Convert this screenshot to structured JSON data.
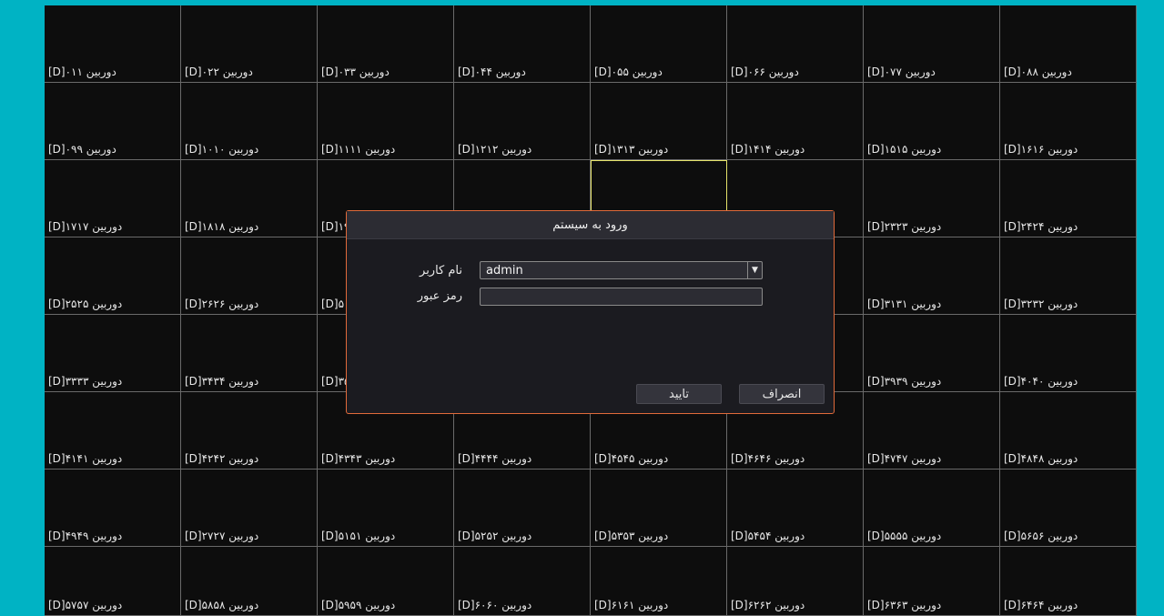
{
  "cameras": [
    "[D]۰۱دوربین ۱",
    "[D]۰۲دوربین ۲",
    "[D]۰۳دوربین ۳",
    "[D]۰۴دوربین ۴",
    "[D]۰۵دوربین ۵",
    "[D]۰۶دوربین ۶",
    "[D]۰۷دوربین ۷",
    "[D]۰۸دوربین ۸",
    "[D]۰۹دوربین ۹",
    "[D]۱۰دوربین ۱۰",
    "[D]۱۱دوربین ۱۱",
    "[D]۱۲دوربین ۱۲",
    "[D]۱۳دوربین ۱۳",
    "[D]۱۴دوربین ۱۴",
    "[D]۱۵دوربین ۱۵",
    "[D]۱۶دوربین ۱۶",
    "[D]۱۷دوربین ۱۷",
    "[D]۱۸دوربین ۱۸",
    "[D]۱۹دوربین ۱۹",
    "",
    "",
    "",
    "[D]۲۳دوربین ۲۳",
    "[D]۲۴دوربین ۲۴",
    "[D]۲۵دوربین ۲۵",
    "[D]۲۶دوربین ۲۶",
    "[D]۵۰دوربین ۵۰",
    "",
    "",
    "",
    "[D]۳۱دوربین ۳۱",
    "[D]۳۲دوربین ۳۲",
    "[D]۳۳دوربین ۳۳",
    "[D]۳۴دوربین ۳۴",
    "[D]۳۵دوربین ۳۵",
    "",
    "",
    "",
    "[D]۳۹دوربین ۳۹",
    "[D]۴۰دوربین ۴۰",
    "[D]۴۱دوربین ۴۱",
    "[D]۴۲دوربین ۴۲",
    "[D]۴۳دوربین ۴۳",
    "[D]۴۴دوربین ۴۴",
    "[D]۴۵دوربین ۴۵",
    "[D]۴۶دوربین ۴۶",
    "[D]۴۷دوربین ۴۷",
    "[D]۴۸دوربین ۴۸",
    "[D]۴۹دوربین ۴۹",
    "[D]۲۷دوربین ۲۷",
    "[D]۵۱دوربین ۵۱",
    "[D]۵۲دوربین ۵۲",
    "[D]۵۳دوربین ۵۳",
    "[D]۵۴دوربین ۵۴",
    "[D]۵۵دوربین ۵۵",
    "[D]۵۶دوربین ۵۶",
    "[D]۵۷دوربین ۵۷",
    "[D]۵۸دوربین ۵۸",
    "[D]۵۹دوربین ۵۹",
    "[D]۶۰دوربین ۶۰",
    "[D]۶۱دوربین ۶۱",
    "[D]۶۲دوربین ۶۲",
    "[D]۶۳دوربین ۶۳",
    "[D]۶۴دوربین ۶۴"
  ],
  "selected_camera_index": 20,
  "login": {
    "title": "ورود به سیستم",
    "username_label": "نام کاربر",
    "username_value": "admin",
    "password_label": "رمز عبور",
    "password_value": "",
    "confirm_label": "تایید",
    "cancel_label": "انصراف"
  },
  "colors": {
    "background": "#00b3c4",
    "dialog_border": "#e06a3a",
    "selected_cell": "#e6e36a"
  }
}
